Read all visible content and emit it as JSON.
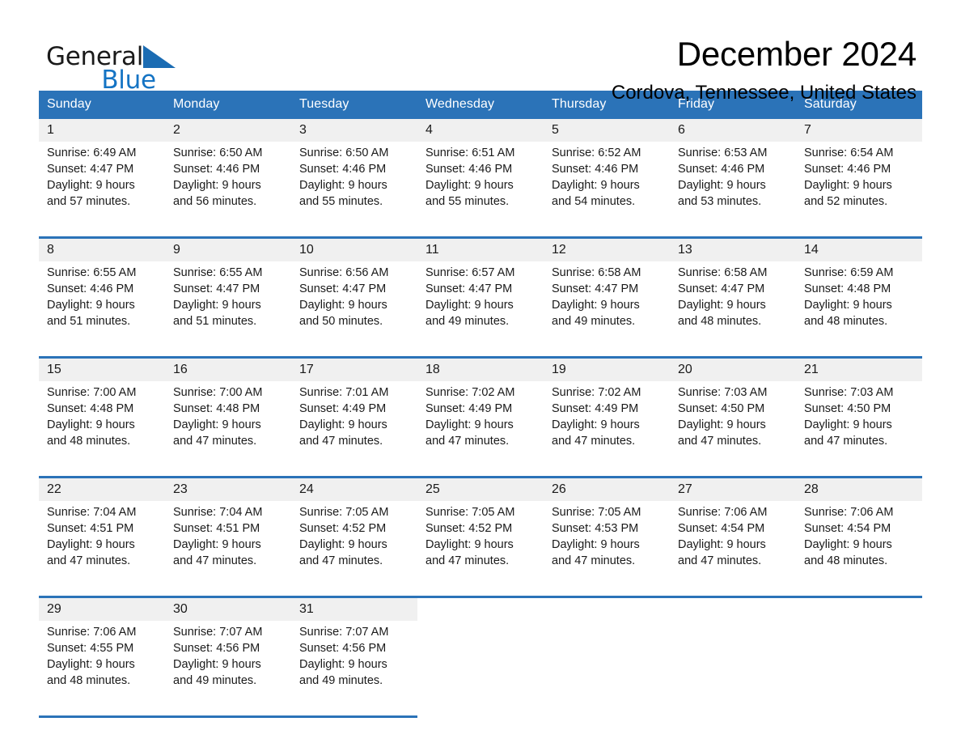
{
  "brand": {
    "word1": "General",
    "word2": "Blue",
    "triangle_color": "#1b6cb3",
    "blue_color": "#1574c4",
    "icon": "triangle-logo-icon"
  },
  "header": {
    "month_title": "December 2024",
    "location": "Cordova, Tennessee, United States"
  },
  "theme": {
    "header_bg": "#2b73b8",
    "daynum_bg": "#f0f0f0",
    "rule_color": "#2b73b8",
    "text_color": "#1a1a1a"
  },
  "weekdays": [
    "Sunday",
    "Monday",
    "Tuesday",
    "Wednesday",
    "Thursday",
    "Friday",
    "Saturday"
  ],
  "weeks": [
    {
      "days": [
        {
          "num": "1",
          "sunrise": "Sunrise: 6:49 AM",
          "sunset": "Sunset: 4:47 PM",
          "daylight1": "Daylight: 9 hours",
          "daylight2": "and 57 minutes."
        },
        {
          "num": "2",
          "sunrise": "Sunrise: 6:50 AM",
          "sunset": "Sunset: 4:46 PM",
          "daylight1": "Daylight: 9 hours",
          "daylight2": "and 56 minutes."
        },
        {
          "num": "3",
          "sunrise": "Sunrise: 6:50 AM",
          "sunset": "Sunset: 4:46 PM",
          "daylight1": "Daylight: 9 hours",
          "daylight2": "and 55 minutes."
        },
        {
          "num": "4",
          "sunrise": "Sunrise: 6:51 AM",
          "sunset": "Sunset: 4:46 PM",
          "daylight1": "Daylight: 9 hours",
          "daylight2": "and 55 minutes."
        },
        {
          "num": "5",
          "sunrise": "Sunrise: 6:52 AM",
          "sunset": "Sunset: 4:46 PM",
          "daylight1": "Daylight: 9 hours",
          "daylight2": "and 54 minutes."
        },
        {
          "num": "6",
          "sunrise": "Sunrise: 6:53 AM",
          "sunset": "Sunset: 4:46 PM",
          "daylight1": "Daylight: 9 hours",
          "daylight2": "and 53 minutes."
        },
        {
          "num": "7",
          "sunrise": "Sunrise: 6:54 AM",
          "sunset": "Sunset: 4:46 PM",
          "daylight1": "Daylight: 9 hours",
          "daylight2": "and 52 minutes."
        }
      ]
    },
    {
      "days": [
        {
          "num": "8",
          "sunrise": "Sunrise: 6:55 AM",
          "sunset": "Sunset: 4:46 PM",
          "daylight1": "Daylight: 9 hours",
          "daylight2": "and 51 minutes."
        },
        {
          "num": "9",
          "sunrise": "Sunrise: 6:55 AM",
          "sunset": "Sunset: 4:47 PM",
          "daylight1": "Daylight: 9 hours",
          "daylight2": "and 51 minutes."
        },
        {
          "num": "10",
          "sunrise": "Sunrise: 6:56 AM",
          "sunset": "Sunset: 4:47 PM",
          "daylight1": "Daylight: 9 hours",
          "daylight2": "and 50 minutes."
        },
        {
          "num": "11",
          "sunrise": "Sunrise: 6:57 AM",
          "sunset": "Sunset: 4:47 PM",
          "daylight1": "Daylight: 9 hours",
          "daylight2": "and 49 minutes."
        },
        {
          "num": "12",
          "sunrise": "Sunrise: 6:58 AM",
          "sunset": "Sunset: 4:47 PM",
          "daylight1": "Daylight: 9 hours",
          "daylight2": "and 49 minutes."
        },
        {
          "num": "13",
          "sunrise": "Sunrise: 6:58 AM",
          "sunset": "Sunset: 4:47 PM",
          "daylight1": "Daylight: 9 hours",
          "daylight2": "and 48 minutes."
        },
        {
          "num": "14",
          "sunrise": "Sunrise: 6:59 AM",
          "sunset": "Sunset: 4:48 PM",
          "daylight1": "Daylight: 9 hours",
          "daylight2": "and 48 minutes."
        }
      ]
    },
    {
      "days": [
        {
          "num": "15",
          "sunrise": "Sunrise: 7:00 AM",
          "sunset": "Sunset: 4:48 PM",
          "daylight1": "Daylight: 9 hours",
          "daylight2": "and 48 minutes."
        },
        {
          "num": "16",
          "sunrise": "Sunrise: 7:00 AM",
          "sunset": "Sunset: 4:48 PM",
          "daylight1": "Daylight: 9 hours",
          "daylight2": "and 47 minutes."
        },
        {
          "num": "17",
          "sunrise": "Sunrise: 7:01 AM",
          "sunset": "Sunset: 4:49 PM",
          "daylight1": "Daylight: 9 hours",
          "daylight2": "and 47 minutes."
        },
        {
          "num": "18",
          "sunrise": "Sunrise: 7:02 AM",
          "sunset": "Sunset: 4:49 PM",
          "daylight1": "Daylight: 9 hours",
          "daylight2": "and 47 minutes."
        },
        {
          "num": "19",
          "sunrise": "Sunrise: 7:02 AM",
          "sunset": "Sunset: 4:49 PM",
          "daylight1": "Daylight: 9 hours",
          "daylight2": "and 47 minutes."
        },
        {
          "num": "20",
          "sunrise": "Sunrise: 7:03 AM",
          "sunset": "Sunset: 4:50 PM",
          "daylight1": "Daylight: 9 hours",
          "daylight2": "and 47 minutes."
        },
        {
          "num": "21",
          "sunrise": "Sunrise: 7:03 AM",
          "sunset": "Sunset: 4:50 PM",
          "daylight1": "Daylight: 9 hours",
          "daylight2": "and 47 minutes."
        }
      ]
    },
    {
      "days": [
        {
          "num": "22",
          "sunrise": "Sunrise: 7:04 AM",
          "sunset": "Sunset: 4:51 PM",
          "daylight1": "Daylight: 9 hours",
          "daylight2": "and 47 minutes."
        },
        {
          "num": "23",
          "sunrise": "Sunrise: 7:04 AM",
          "sunset": "Sunset: 4:51 PM",
          "daylight1": "Daylight: 9 hours",
          "daylight2": "and 47 minutes."
        },
        {
          "num": "24",
          "sunrise": "Sunrise: 7:05 AM",
          "sunset": "Sunset: 4:52 PM",
          "daylight1": "Daylight: 9 hours",
          "daylight2": "and 47 minutes."
        },
        {
          "num": "25",
          "sunrise": "Sunrise: 7:05 AM",
          "sunset": "Sunset: 4:52 PM",
          "daylight1": "Daylight: 9 hours",
          "daylight2": "and 47 minutes."
        },
        {
          "num": "26",
          "sunrise": "Sunrise: 7:05 AM",
          "sunset": "Sunset: 4:53 PM",
          "daylight1": "Daylight: 9 hours",
          "daylight2": "and 47 minutes."
        },
        {
          "num": "27",
          "sunrise": "Sunrise: 7:06 AM",
          "sunset": "Sunset: 4:54 PM",
          "daylight1": "Daylight: 9 hours",
          "daylight2": "and 47 minutes."
        },
        {
          "num": "28",
          "sunrise": "Sunrise: 7:06 AM",
          "sunset": "Sunset: 4:54 PM",
          "daylight1": "Daylight: 9 hours",
          "daylight2": "and 48 minutes."
        }
      ]
    },
    {
      "days": [
        {
          "num": "29",
          "sunrise": "Sunrise: 7:06 AM",
          "sunset": "Sunset: 4:55 PM",
          "daylight1": "Daylight: 9 hours",
          "daylight2": "and 48 minutes."
        },
        {
          "num": "30",
          "sunrise": "Sunrise: 7:07 AM",
          "sunset": "Sunset: 4:56 PM",
          "daylight1": "Daylight: 9 hours",
          "daylight2": "and 49 minutes."
        },
        {
          "num": "31",
          "sunrise": "Sunrise: 7:07 AM",
          "sunset": "Sunset: 4:56 PM",
          "daylight1": "Daylight: 9 hours",
          "daylight2": "and 49 minutes."
        },
        null,
        null,
        null,
        null
      ]
    }
  ]
}
